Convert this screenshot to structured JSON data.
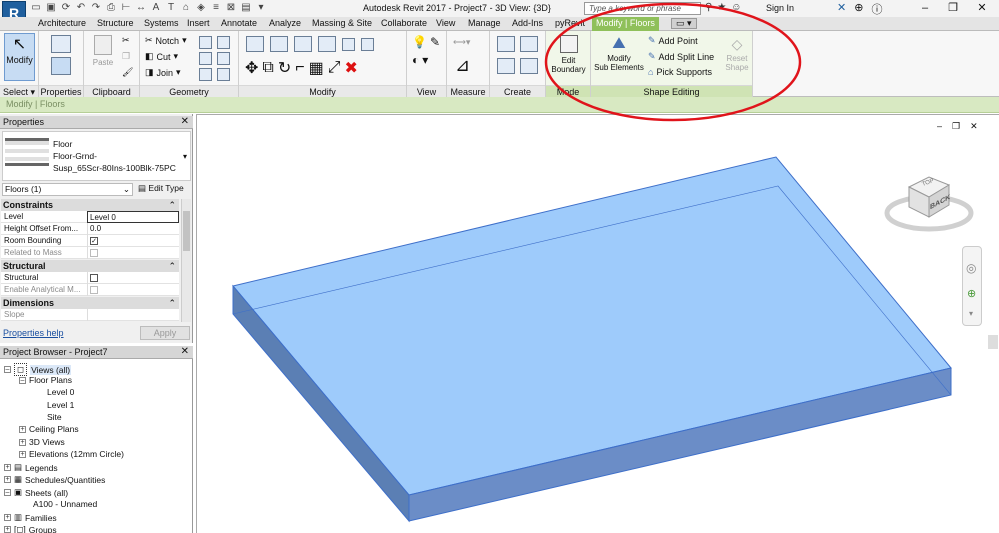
{
  "app": {
    "logo": "R",
    "window_title": "Autodesk Revit 2017 -   Project7 - 3D View: {3D}",
    "search_placeholder": "Type a keyword or phrase",
    "sign_in": "Sign In"
  },
  "tabs": [
    {
      "label": "Architecture"
    },
    {
      "label": "Structure"
    },
    {
      "label": "Systems"
    },
    {
      "label": "Insert"
    },
    {
      "label": "Annotate"
    },
    {
      "label": "Analyze"
    },
    {
      "label": "Massing & Site"
    },
    {
      "label": "Collaborate"
    },
    {
      "label": "View"
    },
    {
      "label": "Manage"
    },
    {
      "label": "Add-Ins"
    },
    {
      "label": "pyRevit"
    },
    {
      "label": "Modify | Floors"
    }
  ],
  "ribbon": {
    "modify": {
      "label": "Modify",
      "panel": "Select ▾"
    },
    "properties_panel": "Properties",
    "clipboard": {
      "paste": "Paste",
      "panel": "Clipboard"
    },
    "geometry": {
      "notch": "Notch",
      "cut": "Cut",
      "join": "Join",
      "panel": "Geometry"
    },
    "modify_panel": "Modify",
    "view_panel": "View",
    "measure_panel": "Measure",
    "create_panel": "Create",
    "mode": {
      "edit_boundary_1": "Edit",
      "edit_boundary_2": "Boundary",
      "panel": "Mode"
    },
    "shape_editing": {
      "modify_sub_1": "Modify",
      "modify_sub_2": "Sub Elements",
      "add_point": "Add Point",
      "add_split_line": "Add Split Line",
      "pick_supports": "Pick Supports",
      "reset_shape_1": "Reset",
      "reset_shape_2": "Shape",
      "panel": "Shape Editing"
    }
  },
  "options_bar": {
    "label": "Modify | Floors"
  },
  "properties": {
    "header": "Properties",
    "type_family": "Floor",
    "type_name_1": "Floor-Grnd-",
    "type_name_2": "Susp_65Scr-80Ins-100Blk-75PC",
    "selector": "Floors (1)",
    "edit_type": "Edit Type",
    "sections": {
      "constraints": "Constraints",
      "structural": "Structural",
      "dimensions": "Dimensions"
    },
    "rows": {
      "level_key": "Level",
      "level_val": "Level 0",
      "height_key": "Height Offset From...",
      "height_val": "0.0",
      "room_key": "Room Bounding",
      "mass_key": "Related to Mass",
      "structural_key": "Structural",
      "analytical_key": "Enable Analytical M...",
      "slope_key": "Slope"
    },
    "help": "Properties help",
    "apply": "Apply"
  },
  "browser": {
    "header": "Project Browser - Project7",
    "items": [
      "Views (all)",
      "Floor Plans",
      "Level 0",
      "Level 1",
      "Site",
      "Ceiling Plans",
      "3D Views",
      "Elevations (12mm Circle)",
      "Legends",
      "Schedules/Quantities",
      "Sheets (all)",
      "A100 - Unnamed",
      "Families",
      "Groups"
    ]
  },
  "viewcube": {
    "top": "TOP",
    "back": "BACK"
  },
  "colors": {
    "context_tab": "#8fc05a",
    "floor_fill": "#9ecbfb",
    "annotation": "#e0141b"
  }
}
